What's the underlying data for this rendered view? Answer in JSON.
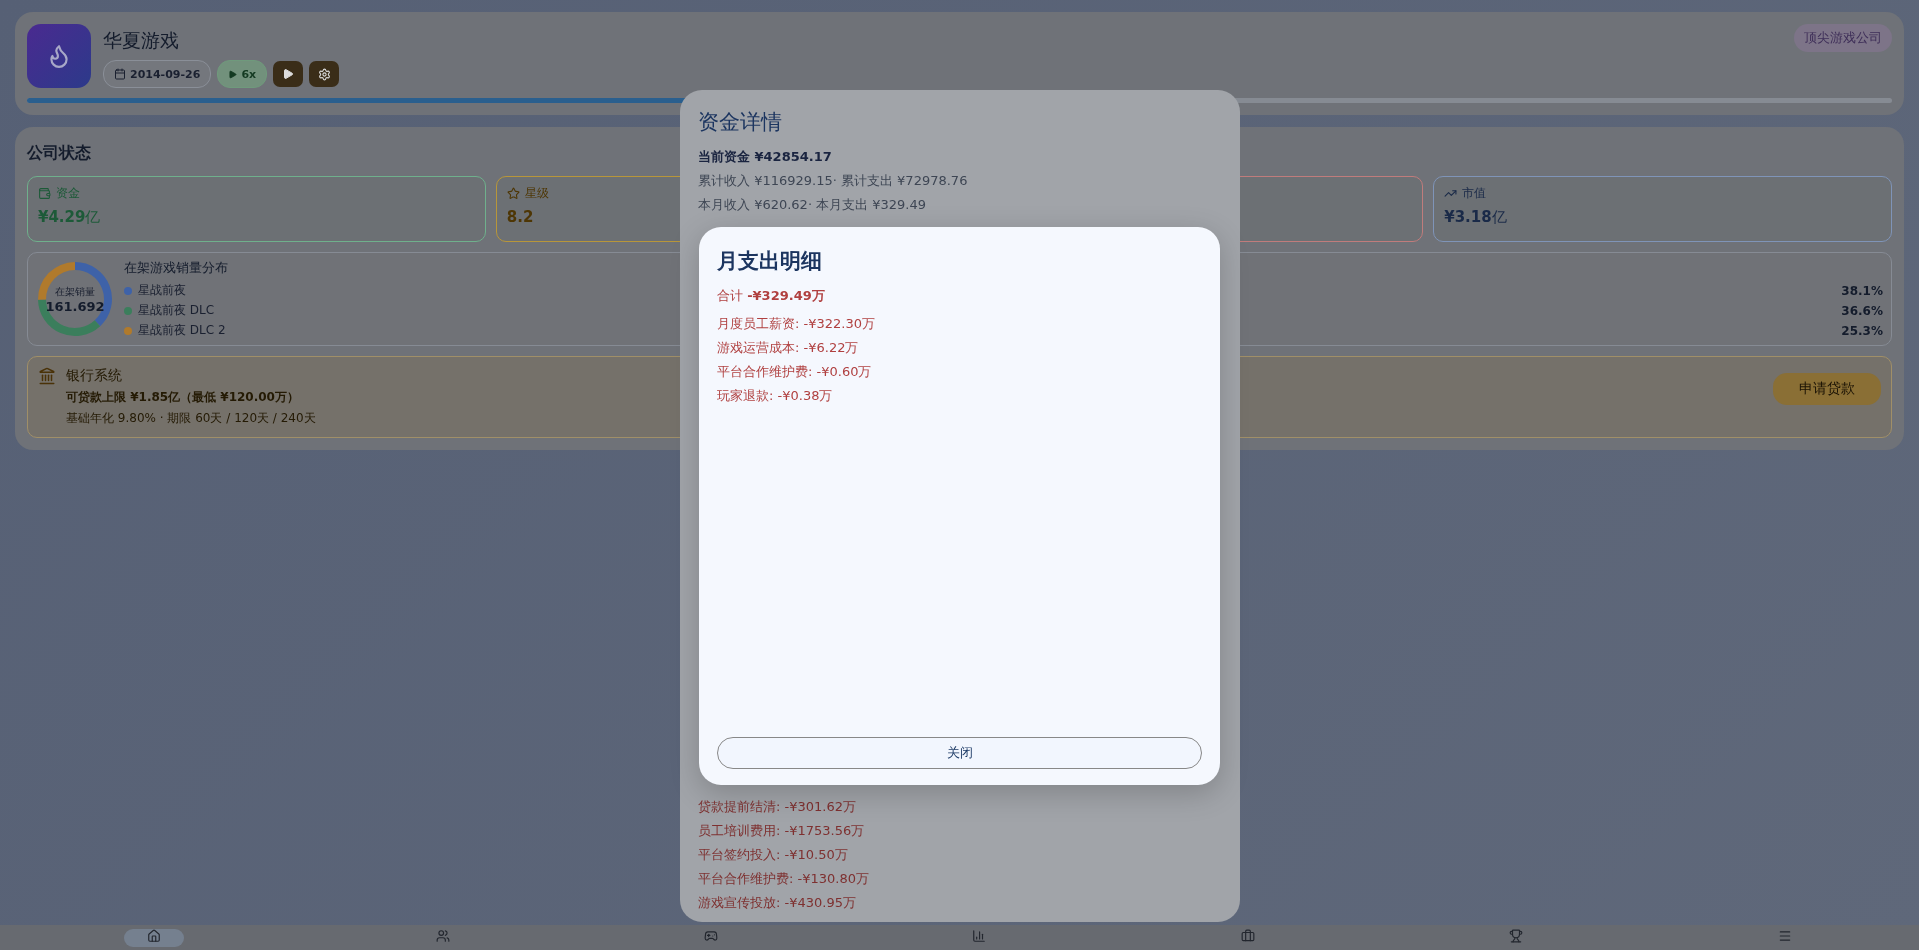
{
  "header": {
    "company": "华夏游戏",
    "date": "2014-09-26",
    "speed": "6x",
    "badge": "顶尖游戏公司",
    "progress": {
      "level": 0.38
    }
  },
  "status": {
    "title": "公司状态",
    "cards": [
      {
        "kind": "wallet",
        "label": "资金",
        "value": "¥4.29",
        "unit": "亿",
        "color": "#6fb08c"
      },
      {
        "kind": "star",
        "label": "星级",
        "value": "8.2",
        "color": "#b8963a"
      },
      {
        "kind": "blank",
        "color": "#c07c7c"
      },
      {
        "kind": "trend",
        "label": "市值",
        "value": "¥3.18",
        "unit": "亿",
        "color": "#7f94b8"
      }
    ]
  },
  "distribution": {
    "title": "在架游戏销量分布",
    "center_label": "在架销量",
    "center_value": "161.692",
    "items": [
      {
        "share": "38.1%",
        "color": "#3e62a8"
      },
      {
        "share": "36.6%",
        "color": "#3b7e5c"
      },
      {
        "share": "25.3%",
        "color": "#b07a2c"
      }
    ],
    "chart_data": {
      "type": "donut",
      "categories": [
        "星战前夜",
        "星战前夜 DLC",
        "星战前夜 DLC 2"
      ],
      "values": [
        38.1,
        36.6,
        25.3
      ]
    }
  },
  "bank": {
    "title": "银行系统",
    "limit": "可贷款上限 ¥1.85亿（最低 ¥120.00万）",
    "terms": "基础年化 9.80% · 期限 60天 / 120天 / 240天",
    "button": "申请贷款"
  },
  "funds_modal": {
    "title": "资金详情",
    "current": "当前资金 ¥42854.17",
    "lines": [
      "累计收入 ¥116929.15· 累计支出 ¥72978.76",
      "本月收入 ¥620.62· 本月支出 ¥329.49"
    ],
    "expenses": [
      "贷款提前结清: -¥301.62万",
      "员工培训费用: -¥1753.56万",
      "平台签约投入: -¥10.50万",
      "平台合作维护费: -¥130.80万",
      "游戏宣传投放: -¥430.95万"
    ]
  },
  "expense_modal": {
    "title": "月支出明细",
    "total": "合计 **-¥329.49万**",
    "items": [
      "月度员工薪资: -¥322.30万",
      "游戏运营成本: -¥6.22万",
      "平台合作维护费: -¥0.60万",
      "玩家退款: -¥0.38万"
    ],
    "close": "关闭"
  }
}
